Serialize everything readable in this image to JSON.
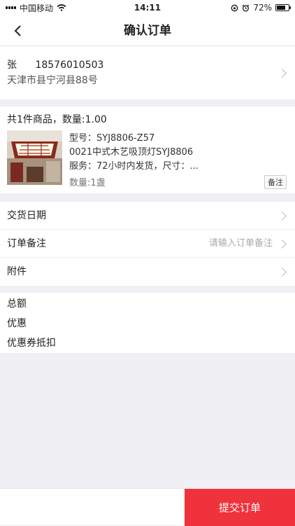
{
  "status_bar": {
    "carrier": "中国移动",
    "time": "14:11",
    "battery": "72%",
    "battery_level": 0.72
  },
  "header": {
    "title": "确认订单"
  },
  "address": {
    "name": "张",
    "phone": "18576010503",
    "detail": "天津市县宁河县88号"
  },
  "goods": {
    "summary": "共1件商品，数量:1.00",
    "model": "型号：SYJ8806-Z57",
    "name": "0021中式木艺吸顶灯SYJ8806",
    "service": "服务：72小时内发货，尺寸：...",
    "quantity": "数量:1盏",
    "note_button": "备注"
  },
  "rows": [
    {
      "label": "交货日期",
      "placeholder": ""
    },
    {
      "label": "订单备注",
      "placeholder": "请输入订单备注"
    },
    {
      "label": "附件",
      "placeholder": ""
    }
  ],
  "totals": {
    "total_label": "总额",
    "discount_label": "优惠",
    "coupon_label": "优惠券抵扣"
  },
  "footer": {
    "submit_label": "提交订单"
  }
}
